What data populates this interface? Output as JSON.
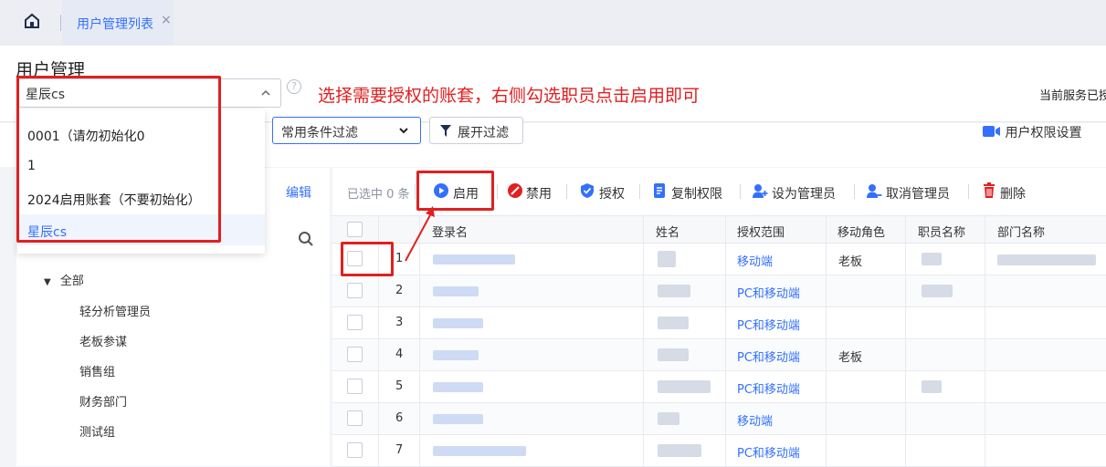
{
  "colors": {
    "accent": "#3370ff",
    "annotation_red": "#e02020",
    "danger": "#e02020"
  },
  "nav": {
    "home_icon": "home-icon",
    "tab_label": "用户管理列表",
    "tab_close": "×"
  },
  "header": {
    "title": "用户管理",
    "account_value": "星辰cs",
    "help": "?",
    "annotation": "选择需要授权的账套，右侧勾选职员点击启用即可",
    "service_text": "当前服务已授"
  },
  "dropdown": {
    "options": [
      "0001（请勿初始化0",
      "1",
      "2024启用账套（不要初始化）",
      "星辰cs"
    ],
    "selected": "星辰cs"
  },
  "filters": {
    "common_filter": "常用条件过滤",
    "expand_filter": "展开过滤",
    "permission_settings": "用户权限设置"
  },
  "tree": {
    "edit": "编辑",
    "root": "全部",
    "items": [
      "轻分析管理员",
      "老板参谋",
      "销售组",
      "财务部门",
      "测试组"
    ]
  },
  "toolbar": {
    "selected_count": "已选中 0 条",
    "enable": "启用",
    "disable": "禁用",
    "authorize": "授权",
    "copy_permissions": "复制权限",
    "set_admin": "设为管理员",
    "cancel_admin": "取消管理员",
    "delete": "删除"
  },
  "table": {
    "columns": [
      "登录名",
      "姓名",
      "授权范围",
      "移动角色",
      "职员名称",
      "部门名称"
    ],
    "rows": [
      {
        "index": "1",
        "scope": "移动端",
        "role": "老板"
      },
      {
        "index": "2",
        "scope": "PC和移动端",
        "role": ""
      },
      {
        "index": "3",
        "scope": "PC和移动端",
        "role": ""
      },
      {
        "index": "4",
        "scope": "PC和移动端",
        "role": "老板"
      },
      {
        "index": "5",
        "scope": "PC和移动端",
        "role": ""
      },
      {
        "index": "6",
        "scope": "移动端",
        "role": ""
      },
      {
        "index": "7",
        "scope": "PC和移动端",
        "role": ""
      }
    ]
  }
}
